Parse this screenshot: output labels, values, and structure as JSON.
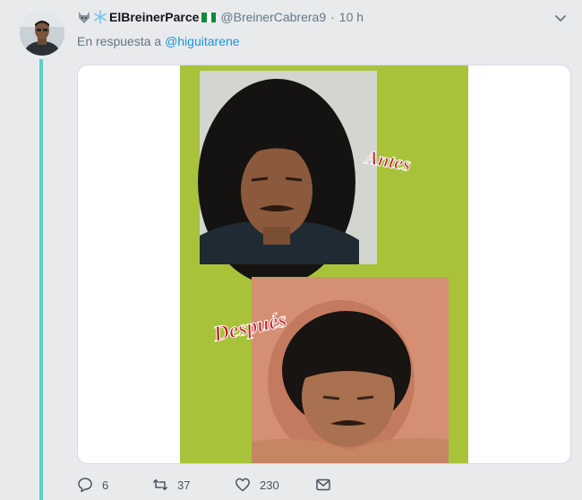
{
  "tweet": {
    "display_name": "ElBreinerParce",
    "handle": "@BreinerCabrera9",
    "separator": "·",
    "time": "10 h",
    "reply_prefix": "En respuesta a",
    "reply_to": "@higuitarene"
  },
  "media": {
    "label_before": "Antes",
    "label_after": "Después"
  },
  "actions": {
    "replies": "6",
    "retweets": "37",
    "likes": "230"
  },
  "colors": {
    "thread_line": "#5fd0c8",
    "link": "#1b95e0",
    "meme_background": "#a8c33a",
    "label_text": "#c81e2c"
  },
  "icons": {
    "name_prefix": [
      "wolf-emoji-icon",
      "snowflake-emoji-icon"
    ],
    "flag": "nigeria-flag-icon"
  }
}
